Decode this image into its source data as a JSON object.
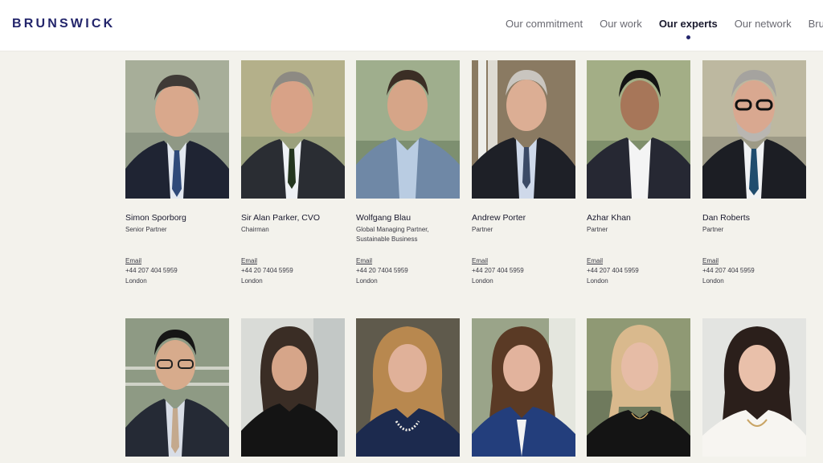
{
  "brand": {
    "logo_text": "BRUNSWICK"
  },
  "nav": {
    "items": [
      "Our commitment",
      "Our work",
      "Our experts",
      "Our network",
      "Bru"
    ],
    "active": "Our experts"
  },
  "experts_row1": [
    {
      "name": "Simon Sporborg",
      "title": "Senior Partner",
      "email_label": "Email",
      "phone": "+44 207 404 5959",
      "city": "London"
    },
    {
      "name": "Sir Alan Parker, CVO",
      "title": "Chairman",
      "email_label": "Email",
      "phone": "+44 20 7404 5959",
      "city": "London"
    },
    {
      "name": "Wolfgang Blau",
      "title": "Global Managing Partner, Sustainable Business",
      "email_label": "Email",
      "phone": "+44 20 7404 5959",
      "city": "London"
    },
    {
      "name": "Andrew Porter",
      "title": "Partner",
      "email_label": "Email",
      "phone": "+44 207 404 5959",
      "city": "London"
    },
    {
      "name": "Azhar Khan",
      "title": "Partner",
      "email_label": "Email",
      "phone": "+44 207 404 5959",
      "city": "London"
    },
    {
      "name": "Dan Roberts",
      "title": "Partner",
      "email_label": "Email",
      "phone": "+44 207 404 5959",
      "city": "London"
    }
  ],
  "colors": {
    "brand": "#23256b",
    "page_bg": "#f3f2ec",
    "header_bg": "#ffffff"
  }
}
